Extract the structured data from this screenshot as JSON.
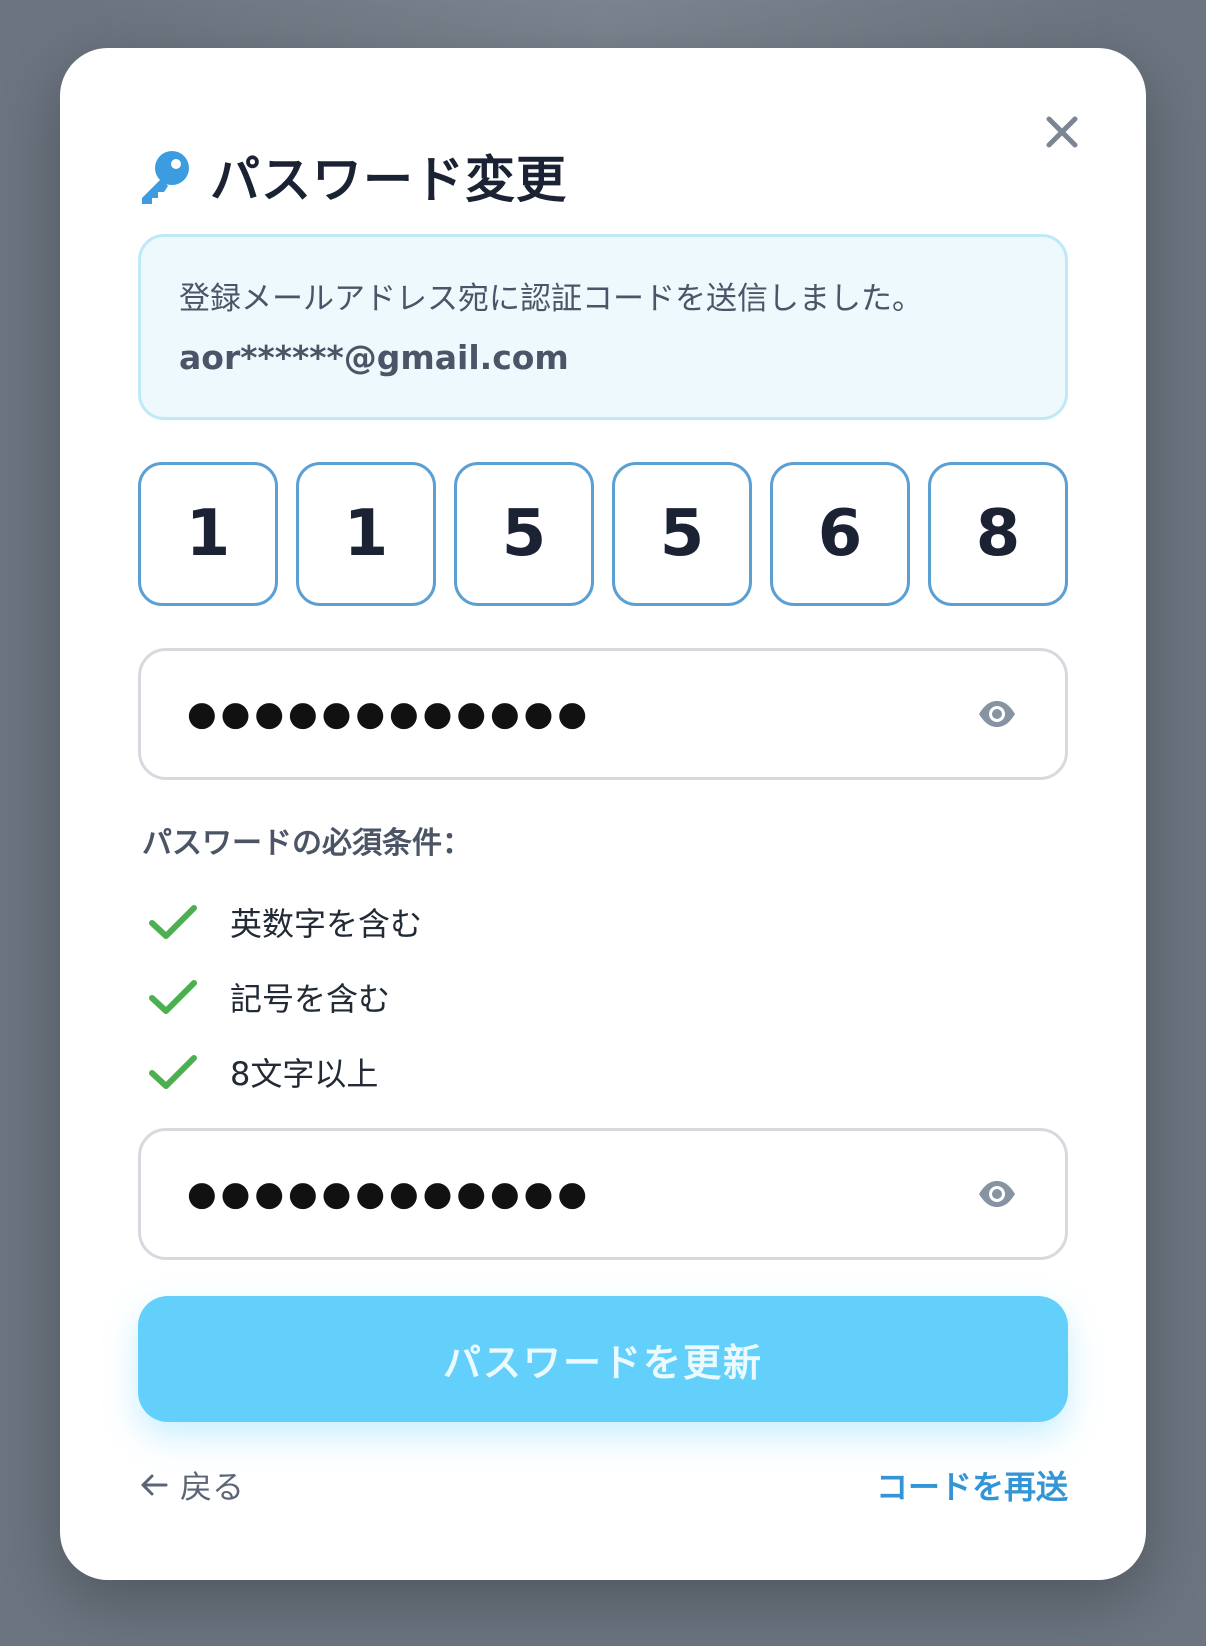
{
  "modal": {
    "title": "パスワード変更",
    "icon": "key-icon",
    "close_icon": "close-icon"
  },
  "info": {
    "message": "登録メールアドレス宛に認証コードを送信しました。",
    "email": "aor******@gmail.com"
  },
  "otp": {
    "digits": [
      "1",
      "1",
      "5",
      "5",
      "6",
      "8"
    ]
  },
  "new_password": {
    "masked_value": "●●●●●●●●●●●●",
    "icon": "eye-icon"
  },
  "confirm_password": {
    "masked_value": "●●●●●●●●●●●●",
    "icon": "eye-icon"
  },
  "requirements": {
    "label": "パスワードの必須条件：",
    "items": [
      {
        "text": "英数字を含む",
        "met": true
      },
      {
        "text": "記号を含む",
        "met": true
      },
      {
        "text": "8文字以上",
        "met": true
      }
    ]
  },
  "actions": {
    "submit_label": "パスワードを更新",
    "back_label": "戻る",
    "resend_label": "コードを再送"
  },
  "colors": {
    "accent": "#62d0fb",
    "link": "#3394d6",
    "check": "#4caf50",
    "otp_border": "#5b9fd3"
  }
}
